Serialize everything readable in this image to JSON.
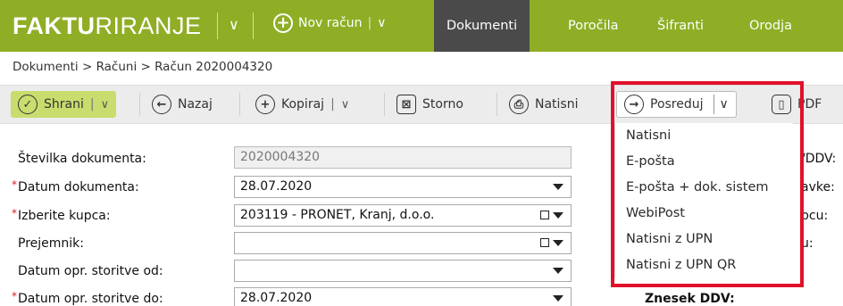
{
  "app": {
    "logo_bold": "FAKTU",
    "logo_thin": "RIRANJE",
    "new_label": "Nov račun",
    "nav_tabs": [
      "Dokumenti",
      "Poročila",
      "Šifranti",
      "Orodja"
    ]
  },
  "breadcrumb": "Dokumenti > Računi > Račun 2020004320",
  "toolbar": {
    "save": "Shrani",
    "back": "Nazaj",
    "copy": "Kopiraj",
    "cancel": "Storno",
    "print": "Natisni",
    "forward": "Posreduj",
    "pdf": "PDF"
  },
  "form": {
    "doc_number_label": "Številka dokumenta:",
    "doc_number_value": "2020004320",
    "doc_date_label": "Datum dokumenta:",
    "doc_date_value": "28.07.2020",
    "customer_label": "Izberite kupca:",
    "customer_value": "203119 - PRONET, Kranj, d.o.o.",
    "recipient_label": "Prejemnik:",
    "recipient_value": "",
    "service_from_label": "Datum opr. storitve od:",
    "service_from_value": "",
    "service_to_label": "Datum opr. storitve do:",
    "service_to_value": "28.07.2020"
  },
  "right_partial": {
    "a": "/DDV:",
    "b": "avke:",
    "c": "pcu:",
    "d": "u:",
    "vat_amount": "Znesek DDV:"
  },
  "forward_menu": [
    "Natisni",
    "E-pošta",
    "E-pošta + dok. sistem",
    "WebiPost",
    "Natisni z UPN",
    "Natisni z UPN QR"
  ],
  "colors": {
    "brand": "#8fae25",
    "active_tab": "#4a4a4a",
    "highlight": "#e0112b",
    "save_button": "#c8dd6e"
  }
}
